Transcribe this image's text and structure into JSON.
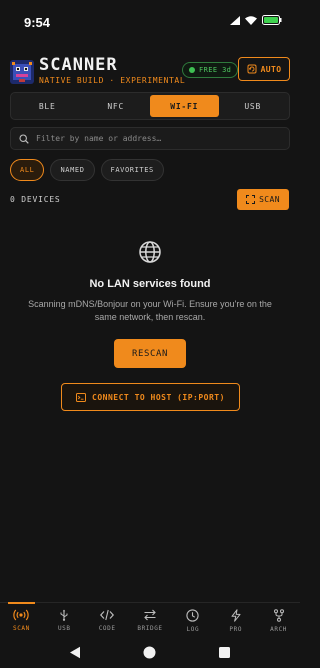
{
  "status_bar": {
    "time": "9:54",
    "icons": [
      "signal-icon",
      "wifi-icon",
      "battery-icon"
    ]
  },
  "header": {
    "title": "SCANNER",
    "subtitle": "NATIVE BUILD · EXPERIMENTAL",
    "free_badge": "FREE 3d",
    "auto_label": "AUTO"
  },
  "tabs": [
    {
      "label": "BLE",
      "active": false
    },
    {
      "label": "NFC",
      "active": false
    },
    {
      "label": "WI-FI",
      "active": true
    },
    {
      "label": "USB",
      "active": false
    }
  ],
  "search": {
    "placeholder": "Filter by name or address…",
    "value": ""
  },
  "filter_chips": [
    {
      "label": "ALL",
      "active": true
    },
    {
      "label": "NAMED",
      "active": false
    },
    {
      "label": "FAVORITES",
      "active": false
    }
  ],
  "devices": {
    "count_label": "0 DEVICES",
    "scan_label": "SCAN"
  },
  "empty_state": {
    "icon": "globe-icon",
    "title": "No LAN services found",
    "description": "Scanning mDNS/Bonjour on your Wi-Fi. Ensure you're on the same network, then rescan.",
    "rescan_label": "RESCAN",
    "connect_label": "CONNECT TO HOST (IP:PORT)"
  },
  "bottom_nav": [
    {
      "label": "SCAN",
      "icon": "broadcast-icon",
      "active": true
    },
    {
      "label": "USB",
      "icon": "usb-icon",
      "active": false
    },
    {
      "label": "CODE",
      "icon": "code-icon",
      "active": false
    },
    {
      "label": "BRIDGE",
      "icon": "swap-icon",
      "active": false
    },
    {
      "label": "LOG",
      "icon": "clock-icon",
      "active": false
    },
    {
      "label": "PRO",
      "icon": "bolt-icon",
      "active": false
    },
    {
      "label": "ARCH",
      "icon": "fork-icon",
      "active": false
    }
  ],
  "colors": {
    "accent": "#f08a1c",
    "background": "#141414",
    "success": "#4ec45f"
  }
}
